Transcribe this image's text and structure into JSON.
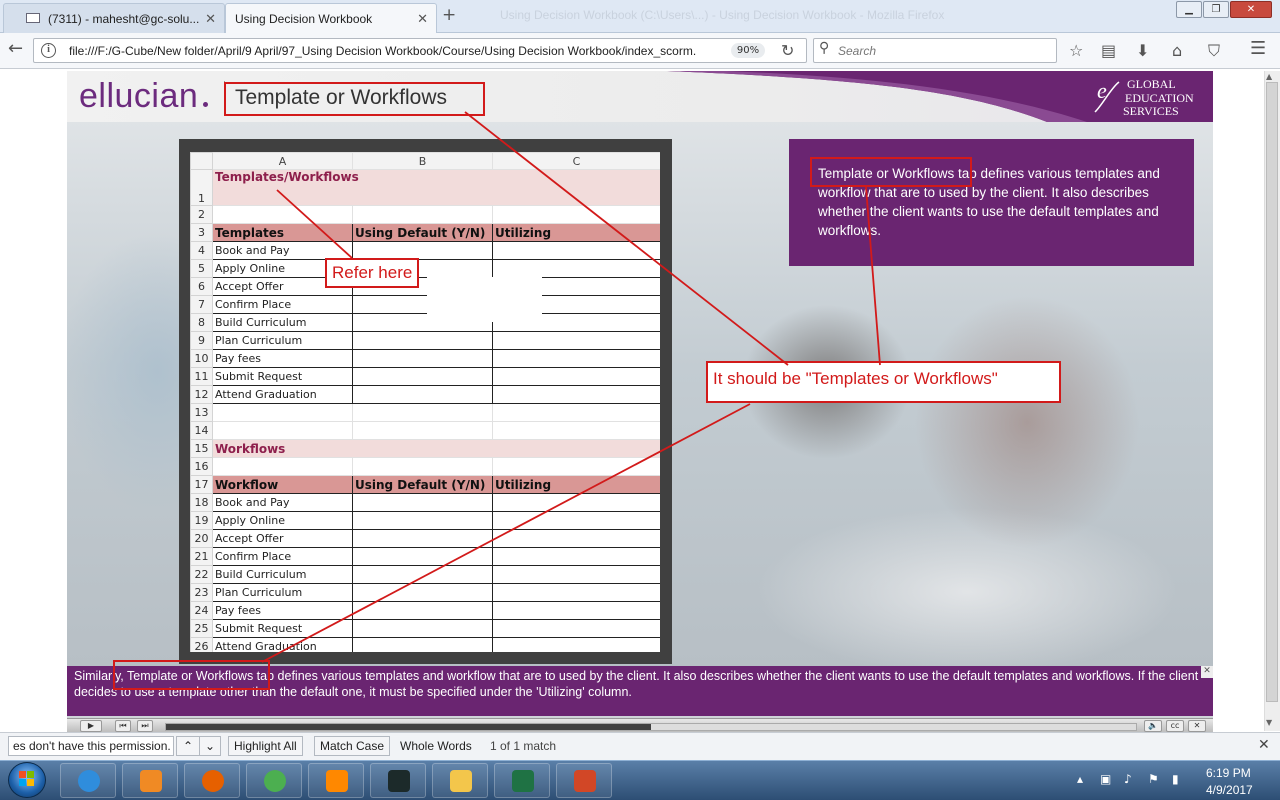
{
  "browser": {
    "tabs": [
      {
        "label": "(7311) - mahesht@gc-solu...",
        "active": false
      },
      {
        "label": "Using Decision Workbook",
        "active": true
      }
    ],
    "ghost_title": "Using Decision Workbook (C:\\Users\\...) - Using Decision Workbook - Mozilla Firefox",
    "url": "file:///F:/G-Cube/New folder/April/9 April/97_Using Decision Workbook/Course/Using Decision Workbook/index_scorm.",
    "zoom": "90%",
    "search_placeholder": "Search"
  },
  "course": {
    "logo_text": "ellucian",
    "page_title": "Template or Workflows",
    "partner_logo": [
      "GLOBAL",
      "EDUCATION",
      "SERVICES"
    ],
    "info_text": "Template or Workflows tab defines various templates and workflow that are to used by the client. It also describes whether the client wants to use the default templates and workflows.",
    "caption": "Similarly, Template or Workflows tab defines various templates and workflow that are to used by the client. It also describes whether the client wants to use the default templates and workflows. If the client decides to use a template other than the default one, it must be specified under the 'Utilizing' column.",
    "progress_fraction": 0.5
  },
  "sheet": {
    "columns": [
      "A",
      "B",
      "C"
    ],
    "section1_title": "Templates/Workflows",
    "section1_headers": [
      "Templates",
      "Using Default (Y/N)",
      "Utilizing"
    ],
    "section1_items": [
      "Book and Pay",
      "Apply Online",
      "Accept Offer",
      "Confirm Place",
      "Build Curriculum",
      "Plan Curriculum",
      "Pay fees",
      "Submit Request",
      "Attend Graduation"
    ],
    "section2_title": "Workflows",
    "section2_headers": [
      "Workflow",
      "Using Default (Y/N)",
      "Utilizing"
    ],
    "section2_items": [
      "Book and Pay",
      "Apply Online",
      "Accept Offer",
      "Confirm Place",
      "Build Curriculum",
      "Plan Curriculum",
      "Pay fees",
      "Submit Request",
      "Attend Graduation"
    ],
    "row_numbers": [
      "1",
      "2",
      "3",
      "4",
      "5",
      "6",
      "7",
      "8",
      "9",
      "10",
      "11",
      "12",
      "13",
      "14",
      "15",
      "16",
      "17",
      "18",
      "19",
      "20",
      "21",
      "22",
      "23",
      "24",
      "25",
      "26"
    ]
  },
  "annotations": {
    "refer_note": "Refer here",
    "fix_note": "It should be \"Templates or Workflows\"",
    "color": "#d21a1a"
  },
  "findbar": {
    "query": "es don't have this permission.",
    "highlight_all": "Highlight All",
    "match_case": "Match Case",
    "whole_words": "Whole Words",
    "status": "1 of 1 match"
  },
  "taskbar": {
    "time": "6:19 PM",
    "date": "4/9/2017",
    "apps": [
      "internet-explorer",
      "media-player",
      "firefox",
      "chrome",
      "vlc",
      "s-app",
      "file-explorer",
      "excel",
      "powerpoint"
    ]
  },
  "colors": {
    "brand_purple": "#6a2571",
    "section_pink": "#f2dcdb",
    "header_rose": "#d99795"
  }
}
